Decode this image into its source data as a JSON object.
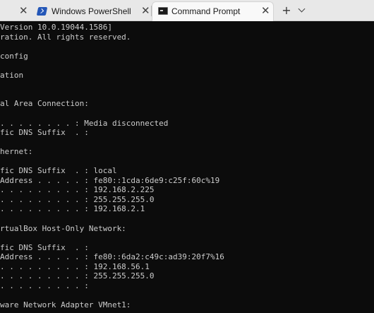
{
  "tabs": [
    {
      "label": "",
      "close": "✕"
    },
    {
      "label": "Windows PowerShell",
      "close": "✕",
      "icon": "powershell-icon"
    },
    {
      "label": "Command Prompt",
      "close": "✕",
      "icon": "command-prompt-icon",
      "active": true
    }
  ],
  "tabbar": {
    "new_tab": "+",
    "dropdown_icon": "chevron-down-icon"
  },
  "console": {
    "foreground": "#cccccc",
    "background": "#0c0c0c",
    "lines": [
      "Version 10.0.19044.1586]",
      "ration. All rights reserved.",
      "",
      "config",
      "",
      "ation",
      "",
      "",
      "al Area Connection:",
      "",
      ". . . . . . . . : Media disconnected",
      "fic DNS Suffix  . :",
      "",
      "hernet:",
      "",
      "fic DNS Suffix  . : local",
      "Address . . . . . : fe80::1cda:6de9:c25f:60c%19",
      ". . . . . . . . . : 192.168.2.225",
      ". . . . . . . . . : 255.255.255.0",
      ". . . . . . . . . : 192.168.2.1",
      "",
      "rtualBox Host-Only Network:",
      "",
      "fic DNS Suffix  . :",
      "Address . . . . . : fe80::6da2:c49c:ad39:20f7%16",
      ". . . . . . . . . : 192.168.56.1",
      ". . . . . . . . . : 255.255.255.0",
      ". . . . . . . . . :",
      "",
      "ware Network Adapter VMnet1:"
    ]
  }
}
